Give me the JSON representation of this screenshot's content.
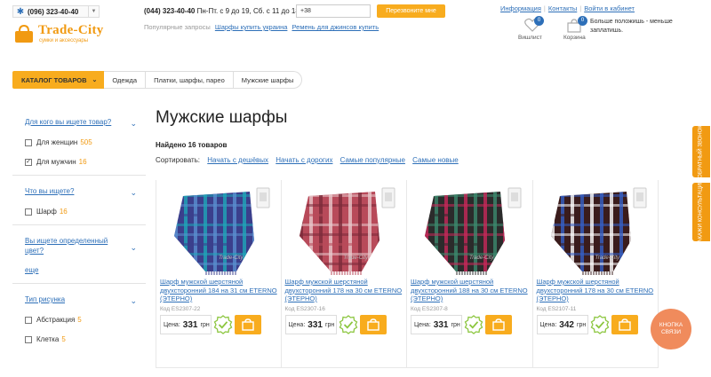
{
  "header": {
    "phone_main": "(096) 323-40-40",
    "brand": "Trade-City",
    "tagline": "сумки и аксессуары",
    "phone_secondary": "(044) 323-40-40",
    "hours": "Пн-Пт. с 9 до 19, Сб. с 11 до 18",
    "callback_input_value": "+38",
    "callback_button": "Перезвоните мне",
    "popular_label": "Популярные запросы",
    "popular_links": [
      "Шарфы купить украина",
      "Ремень для джинсов купить"
    ],
    "top_links": [
      "Информация",
      "Контакты",
      "Войти в кабинет"
    ],
    "wishlist_label": "Вишлист",
    "wishlist_count": "0",
    "cart_label": "Корзина",
    "cart_count": "0",
    "promo_text": "Больше положишь - меньше заплатишь."
  },
  "breadcrumb": {
    "catalog": "КАТАЛОГ ТОВАРОВ",
    "items": [
      "Одежда",
      "Платки, шарфы, парео",
      "Мужские шарфы"
    ]
  },
  "filters": [
    {
      "title": "Для кого вы ищете товар?",
      "options": [
        {
          "label": "Для женщин",
          "count": "505",
          "checked": false
        },
        {
          "label": "Для мужчин",
          "count": "16",
          "checked": true
        }
      ]
    },
    {
      "title": "Что вы ищете?",
      "options": [
        {
          "label": "Шарф",
          "count": "16",
          "checked": false
        }
      ]
    },
    {
      "title": "Вы ищете определенный цвет?",
      "more": "еще",
      "options": []
    },
    {
      "title": "Тип рисунка",
      "options": [
        {
          "label": "Абстракция",
          "count": "5",
          "checked": false
        },
        {
          "label": "Клетка",
          "count": "5",
          "checked": false
        }
      ]
    }
  ],
  "main": {
    "title": "Мужские шарфы",
    "found": "Найдено 16 товаров",
    "sort_label": "Сортировать:",
    "sort_options": [
      "Начать с дешёвых",
      "Начать с дорогих",
      "Самые популярные",
      "Самые новые"
    ]
  },
  "products": [
    {
      "name": "Шарф мужской шерстяной двухсторонний 184 на 31 см ETERNO (ЭТЕРНО)",
      "code": "Код ES2307-22",
      "price_label": "Цена:",
      "price": "331",
      "currency": "грн",
      "colors": [
        "#3b3f8c",
        "#1fa6b8",
        "#5a8fd0"
      ]
    },
    {
      "name": "Шарф мужской шерстяной двухсторонний 178 на 30 см ETERNO (ЭТЕРНО)",
      "code": "Код ES2307-16",
      "price_label": "Цена:",
      "price": "331",
      "currency": "грн",
      "colors": [
        "#b84a5a",
        "#e8c8cc",
        "#7a2a3a"
      ]
    },
    {
      "name": "Шарф мужской шерстяной двухсторонний 188 на 30 см ETERNO (ЭТЕРНО)",
      "code": "Код ES2307-8",
      "price_label": "Цена:",
      "price": "331",
      "currency": "грн",
      "colors": [
        "#2b2b2b",
        "#3c8a6e",
        "#c8285a"
      ]
    },
    {
      "name": "Шарф мужской шерстяной двухсторонний 178 на 30 см ETERNO (ЭТЕРНО)",
      "code": "Код ES2107-11",
      "price_label": "Цена:",
      "price": "342",
      "currency": "грн",
      "colors": [
        "#3a1c1c",
        "#3460c8",
        "#ffffff"
      ]
    }
  ],
  "watermark": "Trade-City",
  "widgets": {
    "callback_tab": "ОБРАТНЫЙ ЗВОНОК",
    "consult_tab": "ЗАКАЖИ КОНСУЛЬТАЦИЮ",
    "contact_button": "КНОПКА СВЯЗИ"
  },
  "colors": {
    "accent": "#f8ac1e",
    "link": "#2d6fb8",
    "check": "#8cc63f"
  }
}
